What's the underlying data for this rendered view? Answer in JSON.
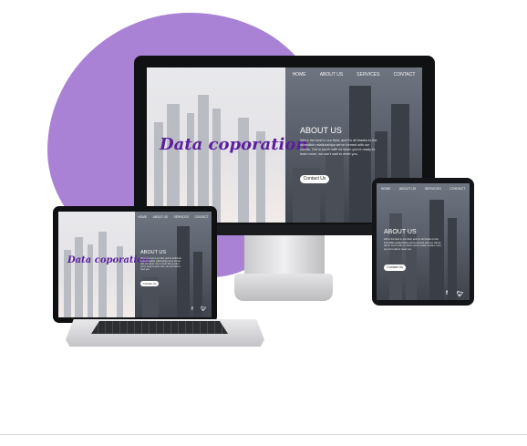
{
  "site": {
    "nav": [
      "HOME",
      "ABOUT US",
      "SERVICES",
      "CONTACT"
    ],
    "logo_text": "Data coporation",
    "about_heading": "ABOUT US",
    "about_body": "We're the best in our field, and it's all thanks to the incredible relationships we've formed with our clients. Get in touch with us when you're ready to learn more, we can't wait to meet you.",
    "cta_label": "Contact Us",
    "social_icons": [
      "facebook-icon",
      "twitter-icon"
    ]
  },
  "colors": {
    "blob": "#a982d6",
    "logo": "#5b1f9e"
  }
}
